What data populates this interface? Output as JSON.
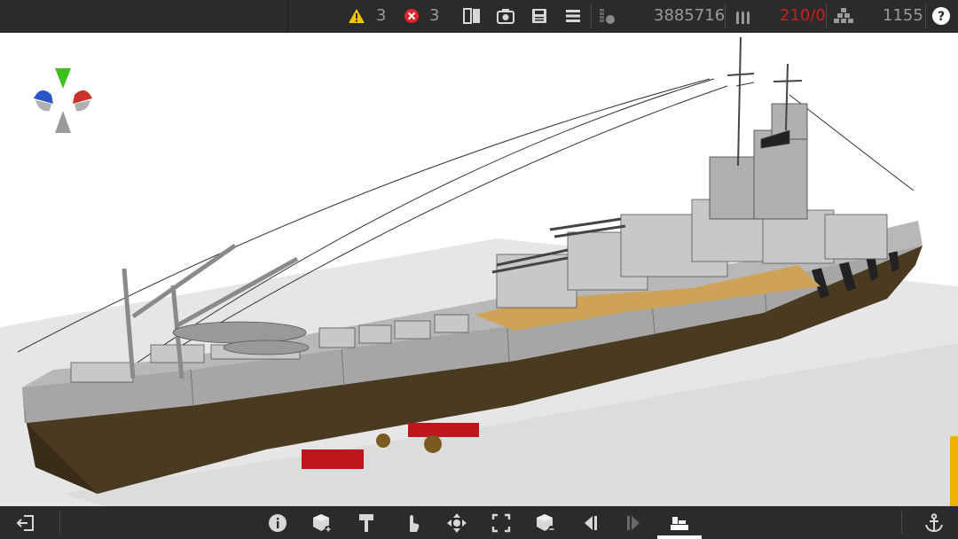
{
  "topbar": {
    "warnings_count": "3",
    "errors_count": "3",
    "cost_value": "3885716",
    "ammo_value": "210/0",
    "weight_value": "1155",
    "icons": [
      "warning-icon",
      "error-icon",
      "split-view-icon",
      "camera-icon",
      "save-icon",
      "menu-icon",
      "cost-icon",
      "ammo-icon",
      "weight-icon",
      "help-icon"
    ]
  },
  "bottombar": {
    "icons": [
      "exit-icon",
      "info-icon",
      "add-part-icon",
      "paint-icon",
      "select-hand-icon",
      "move-icon",
      "resize-icon",
      "remove-part-icon",
      "previous-icon",
      "next-icon",
      "structure-icon",
      "anchor-icon"
    ],
    "active_tool": "structure-icon"
  },
  "colors": {
    "bar_bg": "#2b2b2b",
    "icon": "#d8d8d8",
    "number_text": "#9a9a9a",
    "ammo_text": "#cc1f1f",
    "warning": "#f2c500",
    "error": "#e0262b",
    "side_handle": "#f0b000",
    "hull_grey": "#a6a6a6",
    "hull_lower": "#4b3a22",
    "deck_wood": "#cfa25a",
    "keel_red": "#c0161b"
  },
  "viewport": {
    "orientation_gizmo": [
      "green-axis",
      "red-axis",
      "blue-axis",
      "grey-axis"
    ]
  }
}
